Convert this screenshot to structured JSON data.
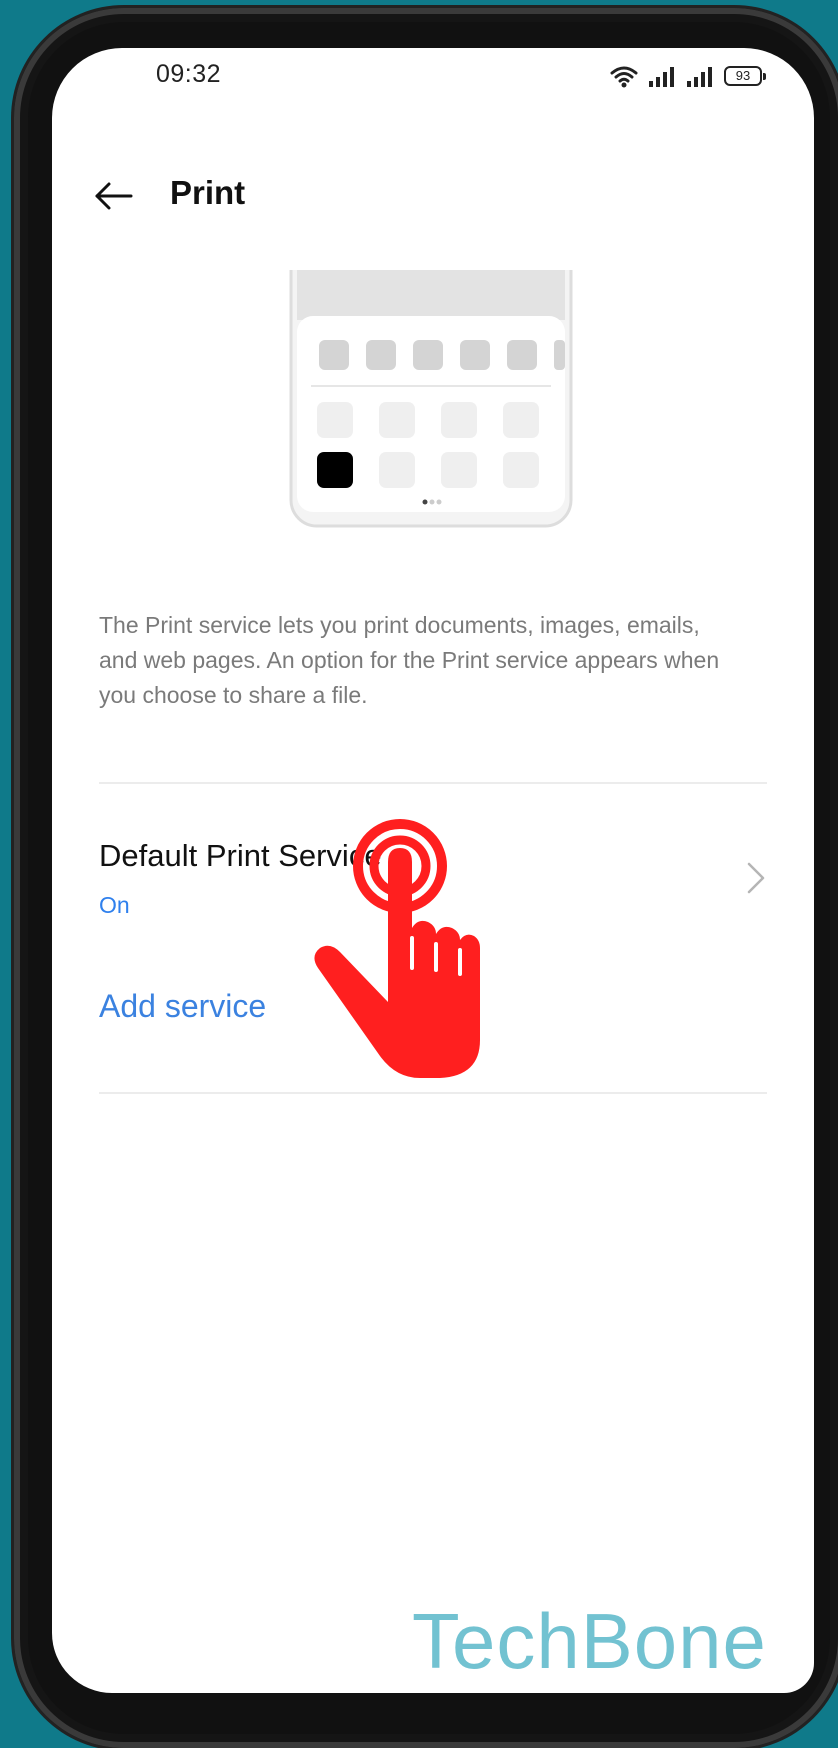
{
  "status_bar": {
    "time": "09:32",
    "battery": "93",
    "icons": [
      "wifi-icon",
      "signal-icon",
      "signal-icon",
      "battery-icon"
    ]
  },
  "header": {
    "title": "Print",
    "back_icon": "arrow-left-icon"
  },
  "description": "The Print service lets you print documents, images, emails, and web pages. An option for the Print service appears when you choose to share a file.",
  "default_service": {
    "title": "Default Print Service",
    "status": "On",
    "chevron_icon": "chevron-right-icon"
  },
  "add_service": {
    "label": "Add service"
  },
  "overlay": {
    "hand_icon": "tap-hand-icon",
    "hand_color": "#ff1f1f"
  },
  "watermark": "TechBone",
  "colors": {
    "background": "#0f7a8a",
    "accent": "#3b82e0",
    "text_secondary": "#7a7a7a"
  }
}
